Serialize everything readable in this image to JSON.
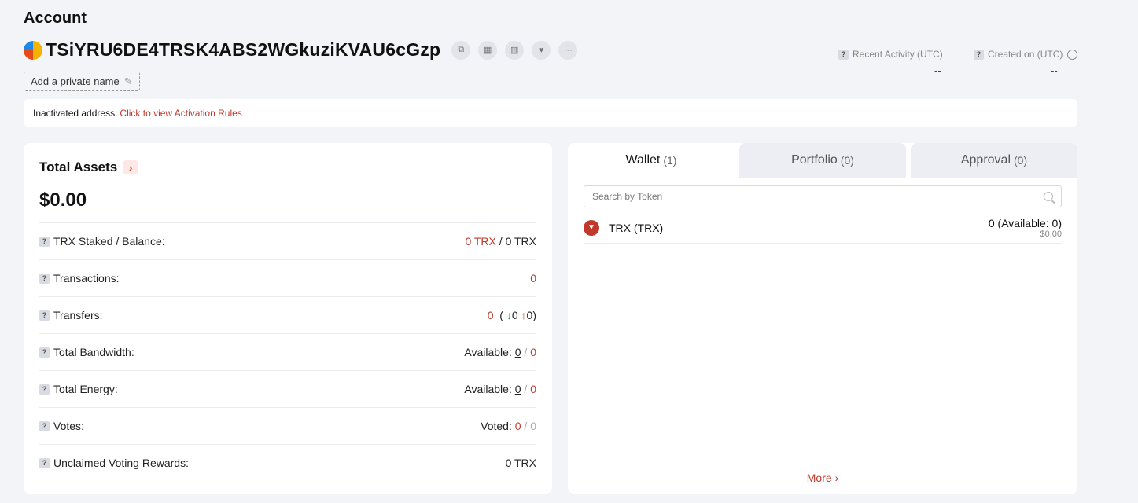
{
  "header": {
    "title": "Account",
    "address": "TSiYRU6DE4TRSK4ABS2WGkuziKVAU6cGzp",
    "private_name_label": "Add a private name",
    "recent_activity_label": "Recent Activity (UTC)",
    "recent_activity_value": "--",
    "created_on_label": "Created on (UTC)",
    "created_on_value": "--"
  },
  "notice": {
    "text": "Inactivated address.",
    "link": "Click to view Activation Rules"
  },
  "assets": {
    "title": "Total Assets",
    "amount": "$0.00",
    "rows": [
      {
        "label": "TRX Staked / Balance:"
      },
      {
        "label": "Transactions:",
        "value": "0"
      },
      {
        "label": "Transfers:"
      },
      {
        "label": "Total Bandwidth:"
      },
      {
        "label": "Total Energy:"
      },
      {
        "label": "Votes:"
      },
      {
        "label": "Unclaimed Voting Rewards:",
        "value": "0 TRX"
      }
    ],
    "staked": "0 TRX",
    "sep": "/",
    "balance": "0 TRX",
    "transfers_total": "0",
    "transfers_in": "0",
    "transfers_out": "0",
    "available_label": "Available:",
    "bandwidth_available": "0",
    "bandwidth_total": "0",
    "energy_available": "0",
    "energy_total": "0",
    "voted_label": "Voted:",
    "voted": "0",
    "votes_total": "0"
  },
  "wallet": {
    "tabs": [
      {
        "label": "Wallet",
        "count": "(1)"
      },
      {
        "label": "Portfolio",
        "count": "(0)"
      },
      {
        "label": "Approval",
        "count": "(0)"
      }
    ],
    "search_placeholder": "Search by Token",
    "token": {
      "name": "TRX (TRX)",
      "amount": "0 (Available: 0)",
      "usd": "$0.00"
    },
    "more_label": "More"
  }
}
